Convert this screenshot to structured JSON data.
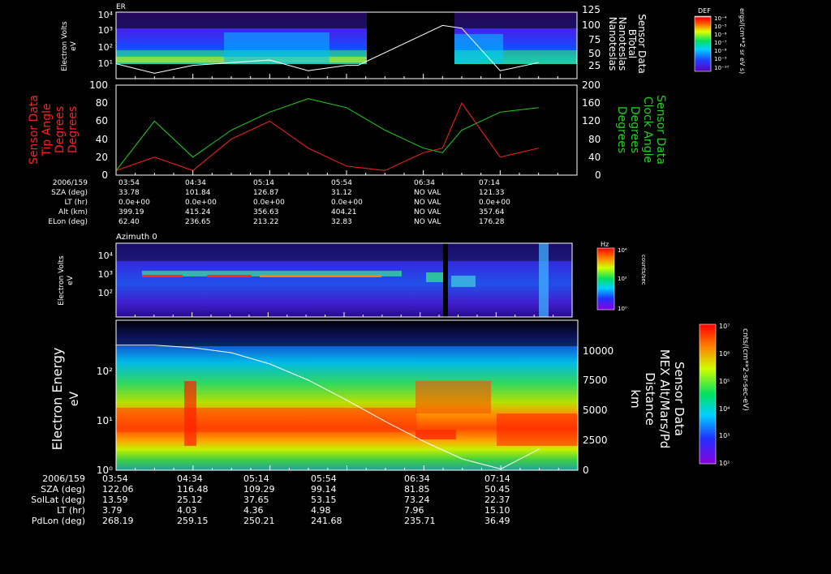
{
  "panel1": {
    "label": "ER",
    "ylabel": [
      "Electron Volts",
      "eV"
    ],
    "yticks": [
      "10⁴",
      "10³",
      "10²",
      "10¹"
    ],
    "right_ticks": [
      "125",
      "100",
      "75",
      "50",
      "25"
    ],
    "right_label": [
      "Sensor Data",
      "BTotal",
      "Nanoteslas",
      "Nanoteslas"
    ],
    "colorbar_title": "DEF",
    "colorbar_ticks": [
      "10⁻⁴",
      "10⁻⁵",
      "10⁻⁶",
      "10⁻⁷",
      "10⁻⁸",
      "10⁻⁹",
      "10⁻¹⁰"
    ],
    "colorbar_unit": "ergs/(cm**2 sr eV s)"
  },
  "panel2": {
    "left_ticks": [
      "100",
      "80",
      "60",
      "40",
      "20",
      "0"
    ],
    "right_ticks": [
      "200",
      "160",
      "120",
      "80",
      "40",
      "0"
    ],
    "left_label": [
      "Sensor Data",
      "Tip Angle",
      "Degrees",
      "Degrees"
    ],
    "right_label": [
      "Sensor Data",
      "Clock Angle",
      "Degrees",
      "Degrees"
    ]
  },
  "ephem1": {
    "labels": [
      "2006/159",
      "SZA (deg)",
      "LT (hr)",
      "Alt (km)",
      "ELon (deg)"
    ],
    "times": [
      "03:54",
      "04:34",
      "05:14",
      "05:54",
      "06:34",
      "07:14"
    ],
    "rows": [
      [
        "33.78",
        "101.84",
        "126.87",
        "31.12",
        "NO VAL",
        "121.33"
      ],
      [
        "0.0e+00",
        "0.0e+00",
        "0.0e+00",
        "0.0e+00",
        "NO VAL",
        "0.0e+00"
      ],
      [
        "399.19",
        "415.24",
        "356.63",
        "404.21",
        "NO VAL",
        "357.64"
      ],
      [
        "62.40",
        "236.65",
        "213.22",
        "32.83",
        "NO VAL",
        "176.28"
      ]
    ]
  },
  "panel3": {
    "title": "Azimuth 0",
    "ylabel": [
      "Electron Volts",
      "eV"
    ],
    "yticks": [
      "10⁴",
      "10³",
      "10²"
    ],
    "colorbar_title": "Hz",
    "colorbar_ticks": [
      "10⁴",
      "10²",
      "10⁰"
    ],
    "colorbar_unit": "counts/sec"
  },
  "panel4": {
    "ylabel": [
      "Electron Energy",
      "eV"
    ],
    "yticks": [
      "10²",
      "10¹",
      "10⁰"
    ],
    "right_ticks": [
      "10000",
      "7500",
      "5000",
      "2500",
      "0"
    ],
    "right_label": [
      "Sensor Data",
      "MEX Alt/Mars/Pd",
      "Distance",
      "km"
    ],
    "colorbar_ticks": [
      "10⁷",
      "10⁶",
      "10⁵",
      "10⁴",
      "10³",
      "10²"
    ],
    "colorbar_unit": "cnts/(cm**2-sr-sec-eV)"
  },
  "ephem2": {
    "labels": [
      "2006/159",
      "SZA (deg)",
      "SolLat (deg)",
      "LT (hr)",
      "PdLon (deg)"
    ],
    "times": [
      "03:54",
      "04:34",
      "05:14",
      "05:54",
      "06:34",
      "07:14"
    ],
    "rows": [
      [
        "122.06",
        "116.48",
        "109.29",
        "99.14",
        "81.85",
        "50.45"
      ],
      [
        "13.59",
        "25.12",
        "37.65",
        "53.15",
        "73.24",
        "22.37"
      ],
      [
        "3.79",
        "4.03",
        "4.36",
        "4.98",
        "7.96",
        "15.10"
      ],
      [
        "268.19",
        "259.15",
        "250.21",
        "241.68",
        "235.71",
        "36.49"
      ]
    ]
  },
  "colors": {
    "tip_angle": "#ff2020",
    "clock_angle": "#20d020",
    "btotal": "#ffffff",
    "altitude": "#ffffff"
  },
  "chart_data": [
    {
      "type": "heatmap",
      "title": "ER",
      "ylabel": "Electron Volts eV",
      "y_scale": "log",
      "ylim": [
        1,
        20000
      ],
      "x_ticks": [
        "03:54",
        "04:34",
        "05:14",
        "05:54",
        "06:34",
        "07:14"
      ],
      "data_gap": [
        "~06:00",
        "~06:44"
      ],
      "overlay_series": {
        "name": "Sensor Data BTotal Nanoteslas",
        "axis": "right",
        "ylim": [
          0,
          125
        ],
        "x": [
          "03:54",
          "04:14",
          "04:34",
          "04:54",
          "05:14",
          "05:34",
          "05:54",
          "06:00",
          "06:44",
          "06:54",
          "07:14",
          "07:34"
        ],
        "values": [
          28,
          10,
          25,
          30,
          35,
          15,
          25,
          25,
          100,
          95,
          15,
          30
        ]
      }
    },
    {
      "type": "line",
      "x_ticks": [
        "03:54",
        "04:34",
        "05:14",
        "05:54",
        "06:34",
        "07:14"
      ],
      "series": [
        {
          "name": "Sensor Data Tip Angle Degrees",
          "axis": "left",
          "ylim": [
            0,
            100
          ],
          "x": [
            "03:54",
            "04:14",
            "04:34",
            "04:54",
            "05:14",
            "05:34",
            "05:54",
            "06:14",
            "06:34",
            "06:44",
            "06:54",
            "07:14",
            "07:34"
          ],
          "values": [
            5,
            20,
            5,
            40,
            60,
            30,
            10,
            5,
            25,
            30,
            80,
            20,
            30
          ]
        },
        {
          "name": "Sensor Data Clock Angle Degrees",
          "axis": "right",
          "ylim": [
            0,
            200
          ],
          "x": [
            "03:54",
            "04:14",
            "04:34",
            "04:54",
            "05:14",
            "05:34",
            "05:54",
            "06:14",
            "06:34",
            "06:44",
            "06:54",
            "07:14",
            "07:34"
          ],
          "values": [
            10,
            120,
            40,
            100,
            140,
            170,
            150,
            100,
            60,
            50,
            100,
            140,
            150
          ]
        }
      ]
    },
    {
      "type": "heatmap",
      "title": "Azimuth 0",
      "ylabel": "Electron Volts eV",
      "y_scale": "log",
      "ylim": [
        10,
        20000
      ],
      "x_ticks": [
        "03:54",
        "04:34",
        "05:14",
        "05:54",
        "06:34",
        "07:14"
      ]
    },
    {
      "type": "heatmap",
      "ylabel": "Electron Energy eV",
      "y_scale": "log",
      "ylim": [
        1,
        700
      ],
      "x_ticks": [
        "03:54",
        "04:34",
        "05:14",
        "05:54",
        "06:34",
        "07:14"
      ],
      "overlay_series": {
        "name": "Sensor Data MEX Alt/Mars/Pd Distance km",
        "axis": "right",
        "ylim": [
          0,
          12000
        ],
        "x": [
          "03:54",
          "04:14",
          "04:34",
          "04:54",
          "05:14",
          "05:34",
          "05:54",
          "06:14",
          "06:34",
          "06:54",
          "07:14",
          "07:34"
        ],
        "values": [
          10000,
          10000,
          9800,
          9400,
          8500,
          7200,
          5600,
          3900,
          2300,
          900,
          100,
          1700
        ]
      }
    }
  ]
}
